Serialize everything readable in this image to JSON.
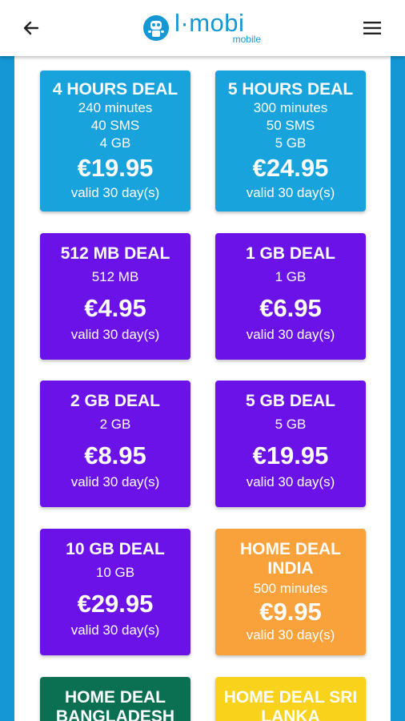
{
  "header": {
    "back_icon": "arrow-left-icon",
    "menu_icon": "hamburger-menu-icon",
    "logo_brand": "l·mobi",
    "logo_sub": "mobile"
  },
  "colors": {
    "accent": "#1497d4",
    "card_blue": "#18a3dd",
    "card_purple": "#6a12e8",
    "card_orange": "#f9a23b",
    "card_green": "#0b6f52",
    "card_yellow": "#f9d21c"
  },
  "deals": [
    {
      "title": "4 HOURS DEAL",
      "line1": "240 minutes",
      "line2": "40 SMS",
      "line3": "4 GB",
      "price": "€19.95",
      "valid": "valid 30 day(s)"
    },
    {
      "title": "5 HOURS DEAL",
      "line1": "300 minutes",
      "line2": "50 SMS",
      "line3": "5 GB",
      "price": "€24.95",
      "valid": "valid 30 day(s)"
    },
    {
      "title": "512 MB DEAL",
      "line1": "512 MB",
      "price": "€4.95",
      "valid": "valid 30 day(s)"
    },
    {
      "title": "1 GB DEAL",
      "line1": "1 GB",
      "price": "€6.95",
      "valid": "valid 30 day(s)"
    },
    {
      "title": "2 GB DEAL",
      "line1": "2 GB",
      "price": "€8.95",
      "valid": "valid 30 day(s)"
    },
    {
      "title": "5 GB DEAL",
      "line1": "5 GB",
      "price": "€19.95",
      "valid": "valid 30 day(s)"
    },
    {
      "title": "10 GB DEAL",
      "line1": "10 GB",
      "price": "€29.95",
      "valid": "valid 30 day(s)"
    },
    {
      "title_line1": "HOME DEAL",
      "title_line2": "INDIA",
      "line1": "500 minutes",
      "price": "€9.95",
      "valid": "valid 30 day(s)"
    },
    {
      "title_line1": "HOME DEAL",
      "title_line2": "BANGLADESH"
    },
    {
      "title_line1": "HOME DEAL SRI",
      "title_line2": "LANKA"
    }
  ]
}
